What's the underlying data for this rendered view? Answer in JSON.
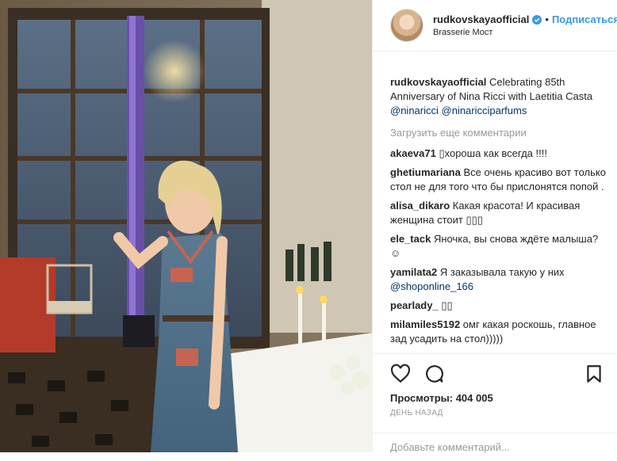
{
  "header": {
    "username": "rudkovskayaofficial",
    "follow_label": "Подписаться",
    "location": "Brasserie Мост"
  },
  "caption": {
    "username": "rudkovskayaofficial",
    "text": " Celebrating 85th Anniversary of Nina Ricci with Laetitia Casta ",
    "mention1": "@ninaricci",
    "mention2": "@ninaricciparfums"
  },
  "load_more": "Загрузить еще комментарии",
  "comments": [
    {
      "user": "akaeva71",
      "text": " ▯хороша как всегда !!!!"
    },
    {
      "user": "ghetiumariana",
      "text": " Все очень красиво вот только стол не для того что бы прислонятся попой ."
    },
    {
      "user": "alisa_dikaro",
      "text": " Какая красота! И красивая женщина стоит ▯▯▯"
    },
    {
      "user": "ele_tack",
      "text": " Яночка, вы снова ждёте малыша?☺"
    },
    {
      "user": "yamilata2",
      "text": " Я заказывала такую у них ",
      "mention": "@shoponline_166"
    },
    {
      "user": "pearlady_",
      "text": " ▯▯"
    },
    {
      "user": "milamiles5192",
      "text": " омг какая роскошь, главное зад усадить на стол)))))"
    }
  ],
  "stats": {
    "views_label": "Просмотры: 404 005",
    "when": "ДЕНЬ НАЗАД"
  },
  "add_comment_placeholder": "Добавьте комментарий...",
  "icons": {
    "like": "heart-icon",
    "comment": "comment-icon",
    "save": "bookmark-icon",
    "verified": "verified-badge-icon"
  },
  "colors": {
    "link": "#3897f0",
    "mention": "#003569",
    "verified": "#3897f0"
  }
}
